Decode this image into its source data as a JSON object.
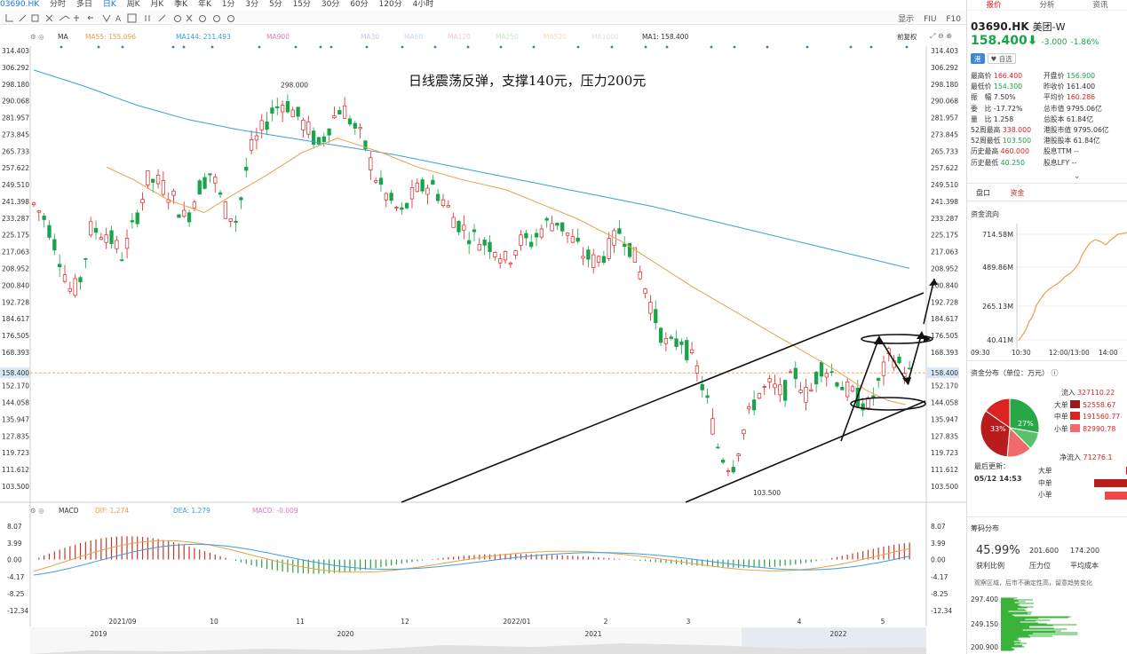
{
  "topbar": {
    "symbol": "03690.HK",
    "periods": [
      "分时",
      "多日",
      "日K",
      "周K",
      "月K",
      "季K",
      "年K",
      "1分",
      "3分",
      "5分",
      "15分",
      "30分",
      "60分",
      "120分",
      "4小时"
    ],
    "active_period": "日K"
  },
  "toolbar_right": [
    "显示",
    "FIU",
    "F10"
  ],
  "ma_bar": {
    "label": "MA",
    "items": [
      {
        "text": "MA55: 155.096",
        "color": "#e8a14a"
      },
      {
        "text": "MA144: 211.493",
        "color": "#3aa0d8"
      },
      {
        "text": "MA900",
        "color": "#e07abf"
      },
      {
        "text": "MA30",
        "color": "#d4c0ea"
      },
      {
        "text": "MA60",
        "color": "#c7d9ef"
      },
      {
        "text": "MA120",
        "color": "#f2c6dc"
      },
      {
        "text": "MA250",
        "color": "#c8e6c9"
      },
      {
        "text": "MA520",
        "color": "#f3dfb0"
      },
      {
        "text": "MA1000",
        "color": "#e0e0e0"
      },
      {
        "text": "MA1: 158.400",
        "color": "#333333"
      }
    ],
    "fuquan": "前复权"
  },
  "chart_data": [
    {
      "type": "candlestick",
      "title": "日线震荡反弹，支撑140元，压力200元",
      "symbol": "03690.HK",
      "y_ticks": [
        "314.403",
        "306.292",
        "298.180",
        "290.068",
        "281.957",
        "273.845",
        "265.733",
        "257.622",
        "249.510",
        "241.398",
        "233.287",
        "225.175",
        "217.063",
        "208.952",
        "200.840",
        "192.728",
        "184.617",
        "176.505",
        "168.393",
        "158.400",
        "152.170",
        "144.058",
        "135.947",
        "127.835",
        "119.723",
        "111.612",
        "103.500"
      ],
      "ylim": [
        103.5,
        314.403
      ],
      "last_price": "158.400",
      "annotations": [
        "298.000",
        "103.500"
      ],
      "x_labels": [
        "2021/09",
        "10",
        "11",
        "12",
        "2022/01",
        "2",
        "3",
        "4",
        "5"
      ],
      "trend_note": "Daily candles: rally to ~298 (Nov 2021), decline to 103.5 (mid-March 2022), rebound to ~158. Ascending channel drawn with arrows pointing to ~200.",
      "series": [
        {
          "name": "MA55",
          "values_approx": [
            null,
            null,
            240,
            238,
            236,
            233,
            232,
            240,
            255,
            268,
            263,
            258,
            250,
            240,
            230,
            220,
            205,
            190,
            178,
            166,
            158,
            155
          ]
        },
        {
          "name": "MA144",
          "values_approx": [
            305,
            297,
            288,
            281,
            276,
            272,
            268,
            264,
            259,
            254,
            249,
            244,
            239,
            233,
            227,
            221,
            215,
            209
          ]
        }
      ]
    },
    {
      "type": "bar",
      "title": "MACD",
      "legend": [
        {
          "text": "DIF: 1.274",
          "color": "#e8a14a"
        },
        {
          "text": "DEA: 1.279",
          "color": "#3aa0d8"
        },
        {
          "text": "MACD: -0.009",
          "color": "#e07abf"
        }
      ],
      "y_ticks": [
        "8.07",
        "3.99",
        "0.00",
        "-4.17",
        "-8.25",
        "-12.34"
      ],
      "ylim": [
        -12.34,
        8.07
      ]
    }
  ],
  "overview_axis": [
    "2019",
    "2020",
    "2021",
    "2022"
  ],
  "sidebar": {
    "tabs": [
      "报价",
      "分析",
      "资讯"
    ],
    "code": "03690.HK",
    "name": "美团-W",
    "price": "158.400",
    "change": "-3.000",
    "change_pct": "-1.86%",
    "btn_fav": "自选",
    "quotes": [
      [
        "最高价",
        "166.400",
        "red",
        "开盘价",
        "156.900",
        "green"
      ],
      [
        "最低价",
        "154.300",
        "green",
        "昨收价",
        "161.400",
        ""
      ],
      [
        "振　幅",
        "7.50%",
        "",
        "平均价",
        "160.286",
        "red"
      ],
      [
        "委　比",
        "-17.72%",
        "",
        "总市值",
        "9795.06亿",
        ""
      ],
      [
        "量　比",
        "1.258",
        "",
        "总股本",
        "61.84亿",
        ""
      ],
      [
        "52周最高",
        "338.000",
        "red",
        "港股市值",
        "9795.06亿",
        ""
      ],
      [
        "52周最低",
        "103.500",
        "green",
        "港股股本",
        "61.84亿",
        ""
      ],
      [
        "历史最高",
        "460.000",
        "red",
        "股息TTM",
        "--",
        ""
      ],
      [
        "历史最低",
        "40.250",
        "green",
        "股息LFY",
        "--",
        ""
      ]
    ],
    "subtabs": [
      "盘口",
      "资金"
    ],
    "flow_title": "资金流向",
    "flow_ticks": [
      "714.58M",
      "489.86M",
      "265.13M",
      "40.41M"
    ],
    "flow_times": [
      "09:30",
      "10:30",
      "12:00/13:00",
      "14:00"
    ],
    "dist_title": "资金分布（单位：万元）",
    "pie": {
      "left_pct": "33%",
      "right_pct": "27%"
    },
    "inflow_label": "流入",
    "inflow_total": "327110.22",
    "rows": [
      {
        "label": "大单",
        "value": "52558.67"
      },
      {
        "label": "中单",
        "value": "191560.77"
      },
      {
        "label": "小单",
        "value": "82990.78"
      }
    ],
    "net_label": "净流入",
    "net_value": "71276.1",
    "updated_label": "最后更新：",
    "updated_time": "05/12 14:53",
    "net_rows": [
      "大单",
      "中单",
      "小单"
    ],
    "chip_title": "筹码分布",
    "chip_vals": [
      {
        "v": "45.99%",
        "l": "获利比例"
      },
      {
        "v": "201.600",
        "l": "压力位"
      },
      {
        "v": "174.200",
        "l": "平均成本"
      }
    ],
    "chip_note": "观察区域，后市不确定性高，留意趋势变化",
    "chip_ticks": [
      "297.400",
      "249.150",
      "200.900"
    ]
  }
}
